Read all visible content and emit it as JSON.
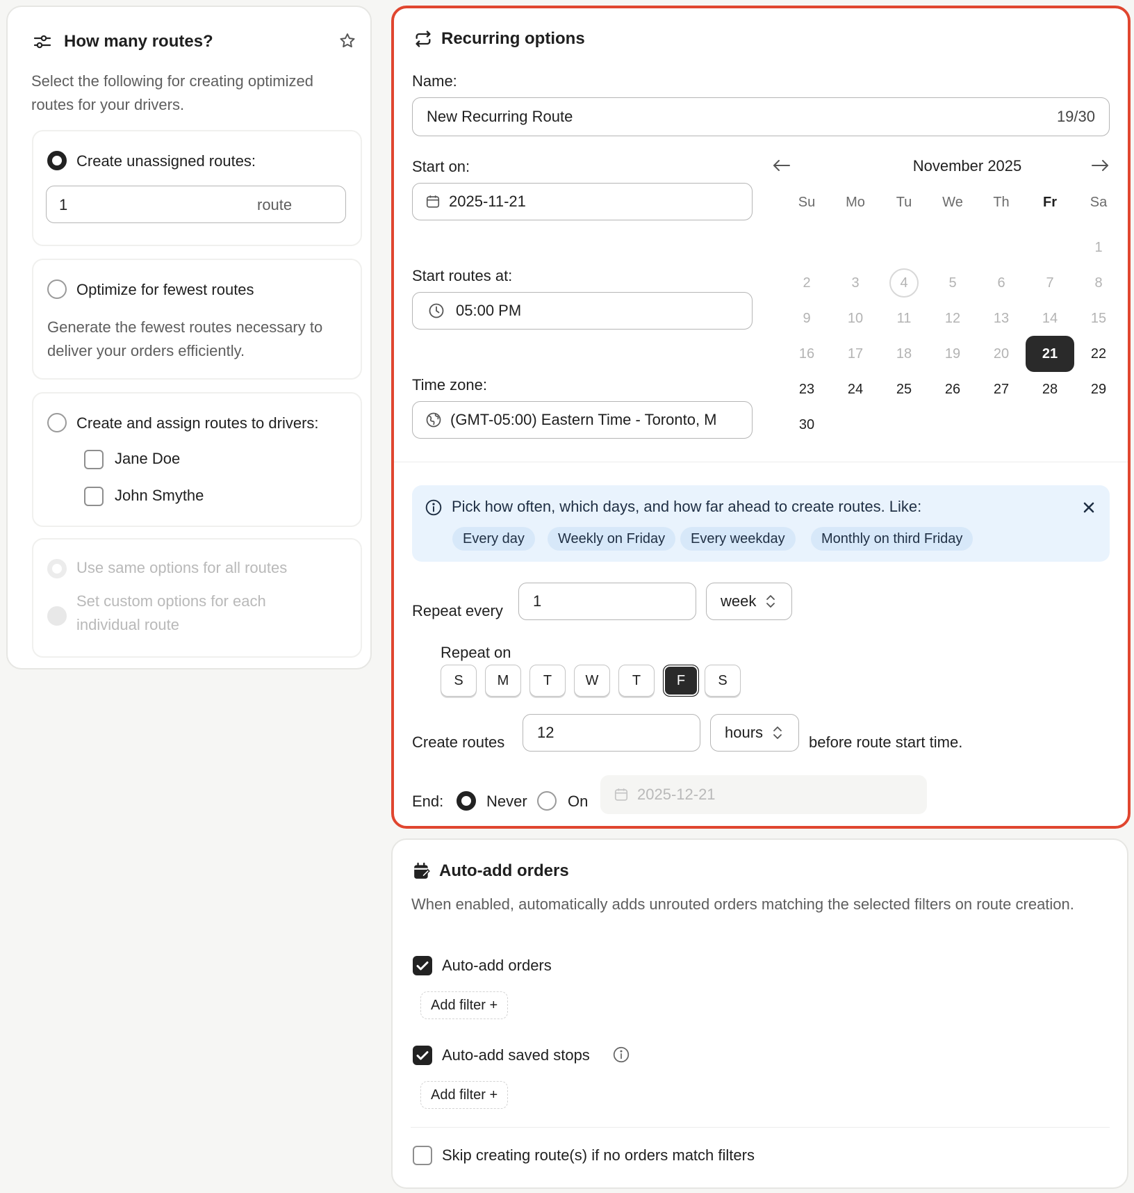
{
  "routes_card": {
    "title": "How many routes?",
    "subtitle": "Select the following for creating optimized routes for your drivers.",
    "unassigned": {
      "label": "Create unassigned routes:",
      "value": "1",
      "suffix": "route"
    },
    "fewest": {
      "label": "Optimize for fewest routes",
      "description": "Generate the fewest routes necessary to deliver your orders efficiently."
    },
    "assign": {
      "label": "Create and assign routes to drivers:",
      "drivers": [
        "Jane Doe",
        "John Smythe"
      ]
    },
    "same_options": "Use same options for all routes",
    "custom_options": "Set custom options for each individual route"
  },
  "recurring": {
    "title": "Recurring options",
    "name_label": "Name:",
    "name_value": "New Recurring Route",
    "name_count": "19/30",
    "start_on_label": "Start on:",
    "start_on_value": "2025-11-21",
    "start_at_label": "Start routes at:",
    "start_at_value": "05:00 PM",
    "timezone_label": "Time zone:",
    "timezone_value": "(GMT-05:00) Eastern Time - Toronto, M",
    "calendar": {
      "month": "November 2025",
      "weekdays": [
        "Su",
        "Mo",
        "Tu",
        "We",
        "Th",
        "Fr",
        "Sa"
      ],
      "selected_day": "21",
      "today": "4"
    },
    "info_text": "Pick how often, which days, and how far ahead to create routes. Like:",
    "chips": [
      "Every day",
      "Weekly on Friday",
      "Every weekday",
      "Monthly on third Friday"
    ],
    "repeat_every_label": "Repeat every",
    "repeat_every_value": "1",
    "repeat_unit": "week",
    "repeat_on_label": "Repeat on",
    "repeat_days": [
      "S",
      "M",
      "T",
      "W",
      "T",
      "F",
      "S"
    ],
    "create_label": "Create routes",
    "create_value": "12",
    "create_unit": "hours",
    "create_suffix": "before route start time.",
    "end_label": "End:",
    "end_never": "Never",
    "end_on": "On",
    "end_date": "2025-12-21"
  },
  "auto_add": {
    "title": "Auto-add orders",
    "description": "When enabled, automatically adds unrouted orders matching the selected filters on route creation.",
    "auto_add_orders": "Auto-add orders",
    "add_filter": "Add filter",
    "auto_add_saved": "Auto-add saved stops",
    "skip_label": "Skip creating route(s) if no orders match filters"
  },
  "colors": {
    "accent_border": "#e0462f",
    "info_bg": "#e9f3fd",
    "selected": "#2a2a2a"
  }
}
